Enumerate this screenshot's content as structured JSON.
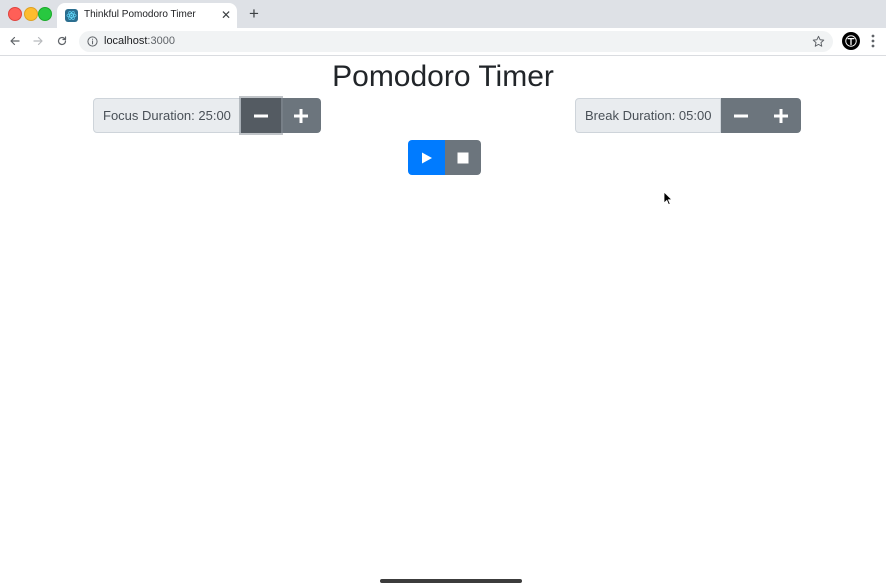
{
  "browser": {
    "tab_title": "Thinkful Pomodoro Timer",
    "tab_close": "✕",
    "new_tab": "+",
    "url_host": "localhost",
    "url_port": ":3000"
  },
  "page": {
    "title": "Pomodoro Timer",
    "focus": {
      "label": "Focus Duration: 25:00"
    },
    "break": {
      "label": "Break Duration: 05:00"
    }
  },
  "colors": {
    "primary": "#007bff",
    "secondary": "#6c757d",
    "addon_bg": "#e9ecef"
  },
  "icons": {
    "decrease": "minus-icon",
    "increase": "plus-icon",
    "play": "play-icon",
    "stop": "stop-icon"
  }
}
